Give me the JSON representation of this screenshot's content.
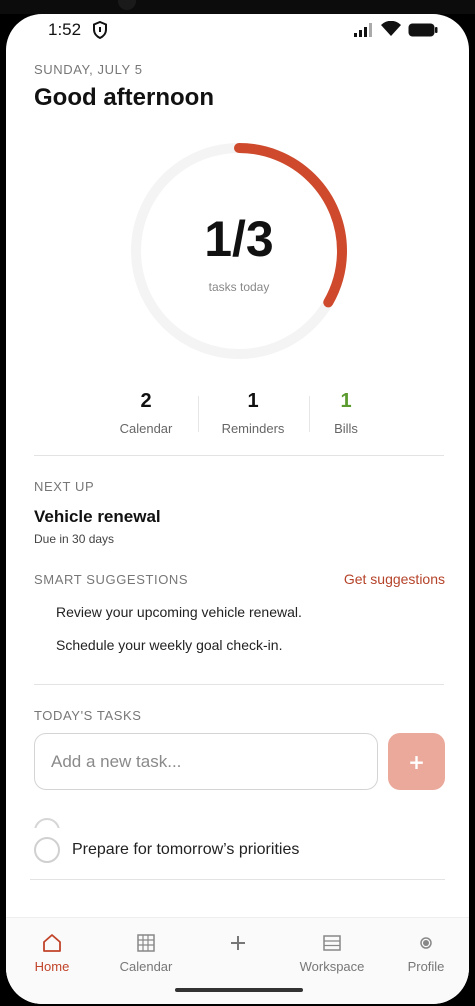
{
  "status_bar": {
    "time": "1:52"
  },
  "header": {
    "date": "SUNDAY, JULY 5",
    "greeting": "Good afternoon"
  },
  "progress": {
    "count_text": "1/3",
    "label": "tasks today",
    "fraction": 0.333,
    "color": "#cf4a2c"
  },
  "stats": [
    {
      "value": "2",
      "label": "Calendar"
    },
    {
      "value": "1",
      "label": "Reminders"
    },
    {
      "value": "1",
      "label": "Bills",
      "color": "#5b9a2f"
    }
  ],
  "next_up": {
    "section_label": "NEXT UP",
    "title": "Vehicle renewal",
    "due": "Due in 30 days"
  },
  "suggestions": {
    "section_label": "SMART SUGGESTIONS",
    "action_label": "Get suggestions",
    "items": [
      "Review your upcoming vehicle renewal.",
      "Schedule your weekly goal check-in."
    ]
  },
  "tasks": {
    "section_label": "TODAY'S TASKS",
    "input_placeholder": "Add a new task...",
    "add_button_label": "+",
    "items": [
      "Prepare for tomorrow’s priorities"
    ]
  },
  "tabbar": {
    "items": [
      {
        "label": "Home",
        "icon": "home-icon",
        "active": true
      },
      {
        "label": "Calendar",
        "icon": "calendar-icon",
        "active": false
      },
      {
        "label": "",
        "icon": "plus-icon",
        "active": false
      },
      {
        "label": "Workspace",
        "icon": "workspace-icon",
        "active": false
      },
      {
        "label": "Profile",
        "icon": "profile-icon",
        "active": false
      }
    ],
    "active_color": "#c1442a"
  }
}
